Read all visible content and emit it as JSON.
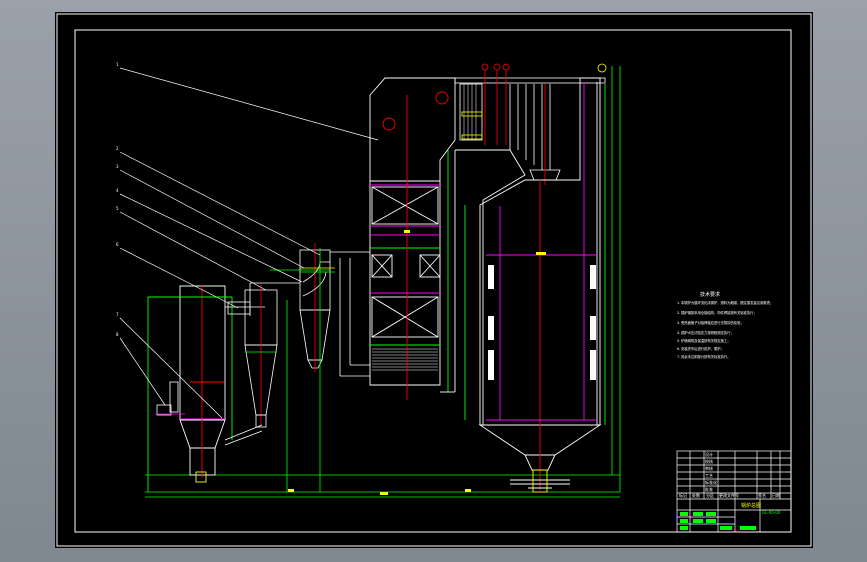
{
  "drawing": {
    "leader_labels": [
      "1",
      "2",
      "3",
      "4",
      "5",
      "6",
      "7",
      "8"
    ],
    "notes_title": "技术要求",
    "notes": [
      "1. 本锅炉为循环流化床锅炉，燃料为烟煤，额定蒸发量见参数表；",
      "2. 锅炉钢架采用全钢结构，构件焊接按有关标准执行；",
      "3. 受热面管子对接焊缝应进行无损探伤检验；",
      "4. 锅炉水压试验压力按规程规定执行；",
      "5. 炉墙砌筑及保温按有关规定施工；",
      "6. 安装完毕后进行烘炉、煮炉；",
      "7. 其余未注明部分按有关标准执行。"
    ],
    "title_block": {
      "title": "锅炉总图",
      "drawing_no": "GL-00-00",
      "rows": [
        "设计",
        "校核",
        "审核",
        "工艺",
        "标准化",
        "批准"
      ],
      "cols": [
        "标记",
        "处数",
        "分区",
        "更改文件号",
        "签名",
        "日期"
      ]
    },
    "colors": {
      "background": "#000000",
      "frame": "#ffffff",
      "structure": "#00ff00",
      "centerline": "#ff0000",
      "walls": "#ffffff",
      "accent": "#ffff00",
      "leader": "#ffffff"
    }
  }
}
